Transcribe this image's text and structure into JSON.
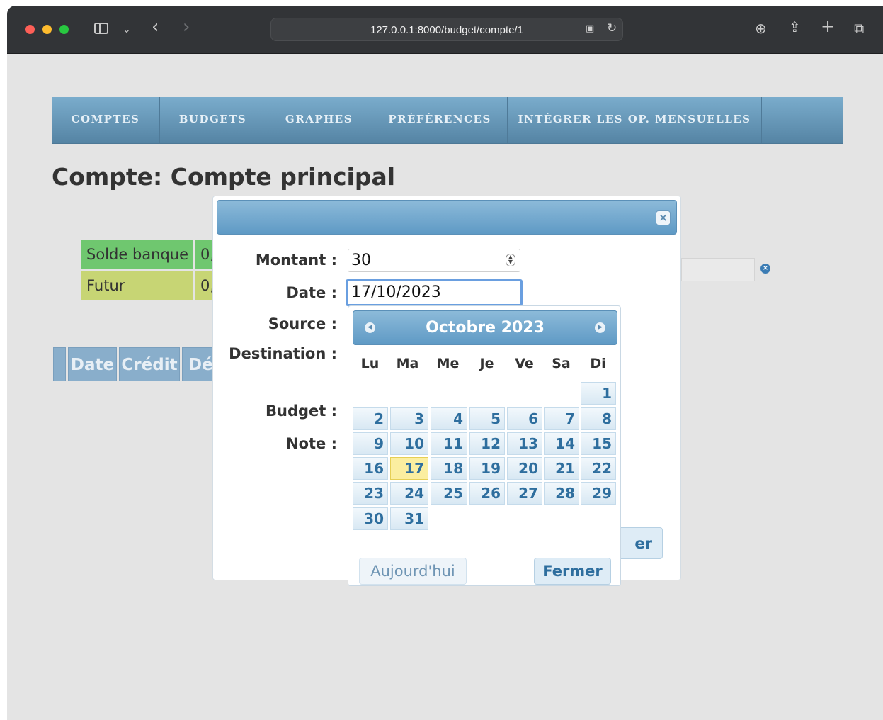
{
  "browser": {
    "url": "127.0.0.1:8000/budget/compte/1"
  },
  "nav": {
    "items": [
      "COMPTES",
      "BUDGETS",
      "GRAPHES",
      "PRÉFÉRENCES",
      "INTÉGRER LES OP. MENSUELLES"
    ]
  },
  "page": {
    "title": "Compte: Compte principal",
    "solde_label": "Solde banque",
    "solde_value": "0,",
    "futur_label": "Futur",
    "futur_value": "0,",
    "table_headers": [
      "Date",
      "Crédit",
      "Dél"
    ]
  },
  "dialog": {
    "labels": {
      "montant": "Montant :",
      "date": "Date :",
      "source": "Source :",
      "destination": "Destination :",
      "budget": "Budget :",
      "note": "Note :"
    },
    "montant_value": "30",
    "date_value": "17/10/2023",
    "save_label_partial": "er"
  },
  "datepicker": {
    "month_year": "Octobre 2023",
    "weekdays": [
      "Lu",
      "Ma",
      "Me",
      "Je",
      "Ve",
      "Sa",
      "Di"
    ],
    "first_weekday_index": 6,
    "days_in_month": 31,
    "selected_day": 17,
    "today_label": "Aujourd'hui",
    "close_label": "Fermer"
  }
}
